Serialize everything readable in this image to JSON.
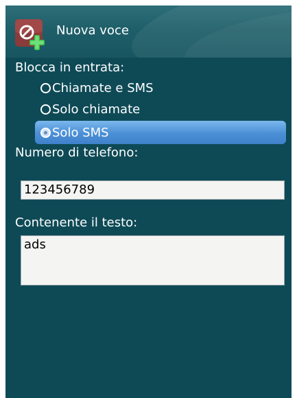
{
  "header": {
    "title": "Nuova voce",
    "icon": "block-add-icon"
  },
  "block_section": {
    "label": "Blocca in entrata:",
    "options": [
      {
        "label": "Chiamate e SMS",
        "selected": false
      },
      {
        "label": "Solo chiamate",
        "selected": false
      },
      {
        "label": "Solo SMS",
        "selected": true
      }
    ]
  },
  "phone": {
    "label": "Numero di telefono:",
    "value": "123456789"
  },
  "text": {
    "label": "Contenente il testo:",
    "value": "ads"
  },
  "colors": {
    "background": "#0e4a56",
    "selection": "#4b8fd6"
  }
}
